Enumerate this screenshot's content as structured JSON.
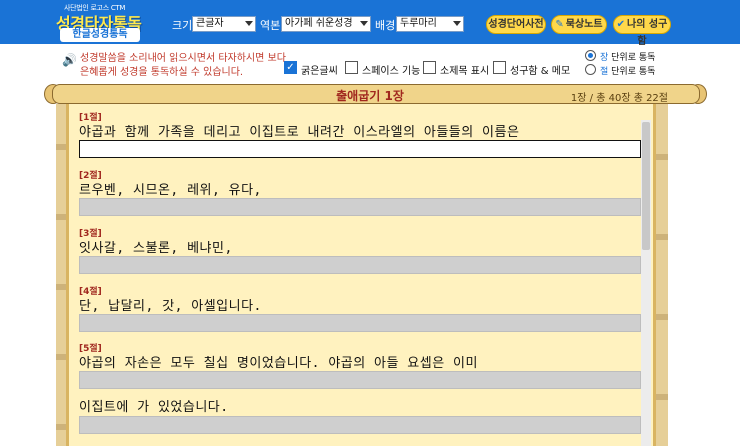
{
  "header": {
    "org": "사단법인 로고스 CTM",
    "title": "성경타자통독",
    "subtitle": "한글성경통독",
    "size_label": "크기",
    "size_value": "큰글자",
    "version_label": "역본",
    "version_value": "아가페 쉬운성경",
    "bg_label": "배경",
    "bg_value": "두루마리",
    "btn_dictionary": "성경단어사전",
    "btn_notes": "묵상노트",
    "btn_myverse": "나의 성구함"
  },
  "options": {
    "notice": "성경말씀을 소리내어 읽으시면서 타자하시면 보다 은혜롭게 성경을 통독하실 수 있습니다.",
    "checkbox_bold": "굵은글씨",
    "checkbox_space": "스페이스 기능",
    "checkbox_subtitle": "소제목 표시",
    "checkbox_memo": "성구함 & 메모",
    "radio_chapter": "장 단위로 통독",
    "radio_chapter_key": "장",
    "radio_chapter_rest": " 단위로 통독",
    "radio_verse": "절 단위로 통독",
    "radio_verse_key": "절",
    "radio_verse_rest": " 단위로 통독",
    "bold_checked": true,
    "space_checked": false,
    "subtitle_checked": false,
    "memo_checked": false,
    "mode": "chapter"
  },
  "chapter": {
    "title": "출애굽기 1장",
    "info": "1장 / 총 40장  총 22절"
  },
  "verses": [
    {
      "num": "[1절]",
      "text": "야곱과 함께 가족을 데리고 이집트로 내려간 이스라엘의 아들들의 이름은"
    },
    {
      "num": "[2절]",
      "text": "르우벤, 시므온, 레위, 유다,"
    },
    {
      "num": "[3절]",
      "text": "잇사갈, 스불론, 베냐민,"
    },
    {
      "num": "[4절]",
      "text": "단, 납달리, 갓, 아셀입니다."
    },
    {
      "num": "[5절]",
      "text": "야곱의 자손은 모두 칠십 명이었습니다. 야곱의 아들 요셉은 이미"
    },
    {
      "num": "",
      "text": "이집트에 가 있었습니다."
    }
  ],
  "colors": {
    "header_bg": "#1a73d6",
    "title_yellow": "#ffe94d",
    "verse_num": "#a0271e",
    "paper": "#fff2bf"
  }
}
